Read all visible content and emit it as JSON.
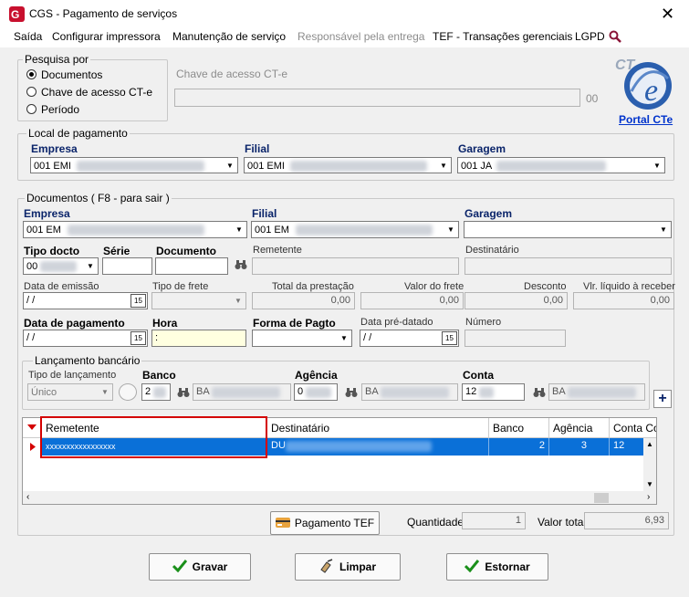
{
  "window": {
    "title": "CGS - Pagamento de serviços",
    "close_glyph": "✕"
  },
  "menu": [
    "Saída",
    "Configurar impressora",
    "Manutenção de serviço",
    "Responsável pela entrega",
    "TEF - Transações gerenciais",
    "LGPD"
  ],
  "pesquisa": {
    "legend": "Pesquisa por",
    "options": [
      "Documentos",
      "Chave de acesso CT-e",
      "Período"
    ],
    "selected": "Documentos",
    "chave_label": "Chave de acesso CT-e",
    "chave_value": "",
    "chave_suffix": "00",
    "portal_link": "Portal CTe",
    "logo_text": "CT",
    "logo_letter": "e"
  },
  "local": {
    "legend": "Local de pagamento",
    "empresa_label": "Empresa",
    "empresa_value": "001 EMI",
    "filial_label": "Filial",
    "filial_value": "001 EMI",
    "garagem_label": "Garagem",
    "garagem_value": "001 JA"
  },
  "documentos": {
    "legend": "Documentos ( F8 - para sair )",
    "empresa_label": "Empresa",
    "empresa_value": "001 EM",
    "filial_label": "Filial",
    "filial_value": "001 EM",
    "garagem_label": "Garagem",
    "garagem_value": "",
    "tipo_docto_label": "Tipo docto",
    "tipo_docto_value": "00",
    "serie_label": "Série",
    "serie_value": "",
    "documento_label": "Documento",
    "documento_value": "",
    "remetente_label": "Remetente",
    "remetente_value": "",
    "destinatario_label": "Destinatário",
    "destinatario_value": "",
    "data_emissao_label": "Data de emissão",
    "data_emissao_value": " / /",
    "tipo_frete_label": "Tipo de frete",
    "tipo_frete_value": "",
    "total_prestacao_label": "Total da prestação",
    "total_prestacao_value": "0,00",
    "valor_frete_label": "Valor do frete",
    "valor_frete_value": "0,00",
    "desconto_label": "Desconto",
    "desconto_value": "0,00",
    "vlr_liquido_label": "Vlr. líquido à receber",
    "vlr_liquido_value": "0,00",
    "data_pagamento_label": "Data de pagamento",
    "data_pagamento_value": " / /",
    "hora_label": "Hora",
    "hora_value": ":",
    "forma_pagto_label": "Forma de Pagto",
    "forma_pagto_value": "",
    "data_pre_label": "Data pré-datado",
    "data_pre_value": " / /",
    "numero_label": "Número",
    "numero_value": "",
    "calendar_glyph": "15"
  },
  "lancamento": {
    "legend": "Lançamento bancário",
    "tipo_label": "Tipo de lançamento",
    "tipo_value": "Único",
    "banco_label": "Banco",
    "banco_value": "2",
    "banco_desc": "BA",
    "agencia_label": "Agência",
    "agencia_value": "0",
    "agencia_desc": "BA",
    "conta_label": "Conta",
    "conta_value": "12",
    "conta_desc": "BA",
    "add_glyph": "+"
  },
  "grid": {
    "columns": [
      "Remetente",
      "Destinatário",
      "Banco",
      "Agência",
      "Conta Corr"
    ],
    "rows": [
      {
        "remetente": "xxxxxxxxxxxxxxxxx",
        "destinatario": "DU",
        "banco": "2",
        "agencia": "3",
        "conta": "12"
      }
    ]
  },
  "footer": {
    "tef_button": "Pagamento TEF",
    "quantidade_label": "Quantidade",
    "quantidade_value": "1",
    "valor_total_label": "Valor total",
    "valor_total_value": "6,93"
  },
  "actions": {
    "gravar": "Gravar",
    "limpar": "Limpar",
    "estornar": "Estornar"
  },
  "colors": {
    "selection": "#0a70d8",
    "highlight_box": "#d40000",
    "portal_link": "#0033cc",
    "confirm_check": "#1a8f1a"
  }
}
